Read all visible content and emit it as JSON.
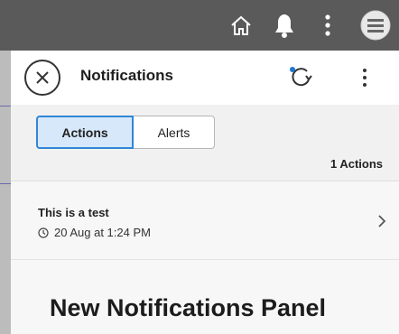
{
  "header": {
    "title": "Notifications"
  },
  "tabs": {
    "actions_label": "Actions",
    "alerts_label": "Alerts",
    "selected": "Actions"
  },
  "count_label": "1 Actions",
  "notification": {
    "title": "This is a test",
    "time": "20 Aug at 1:24 PM"
  },
  "footer_text": "New Notifications Panel",
  "colors": {
    "topbar": "#5a5a5a",
    "accent": "#2f86d6",
    "selected_tab_bg": "#d6e8fa",
    "refresh_dot": "#1a78d0"
  },
  "icons": {
    "topbar": [
      "home-icon",
      "bell-icon",
      "more-vertical-icon",
      "avatar-menu-icon"
    ],
    "header": [
      "close-icon",
      "refresh-icon",
      "more-vertical-icon"
    ],
    "item": [
      "clock-icon",
      "chevron-right-icon"
    ]
  }
}
